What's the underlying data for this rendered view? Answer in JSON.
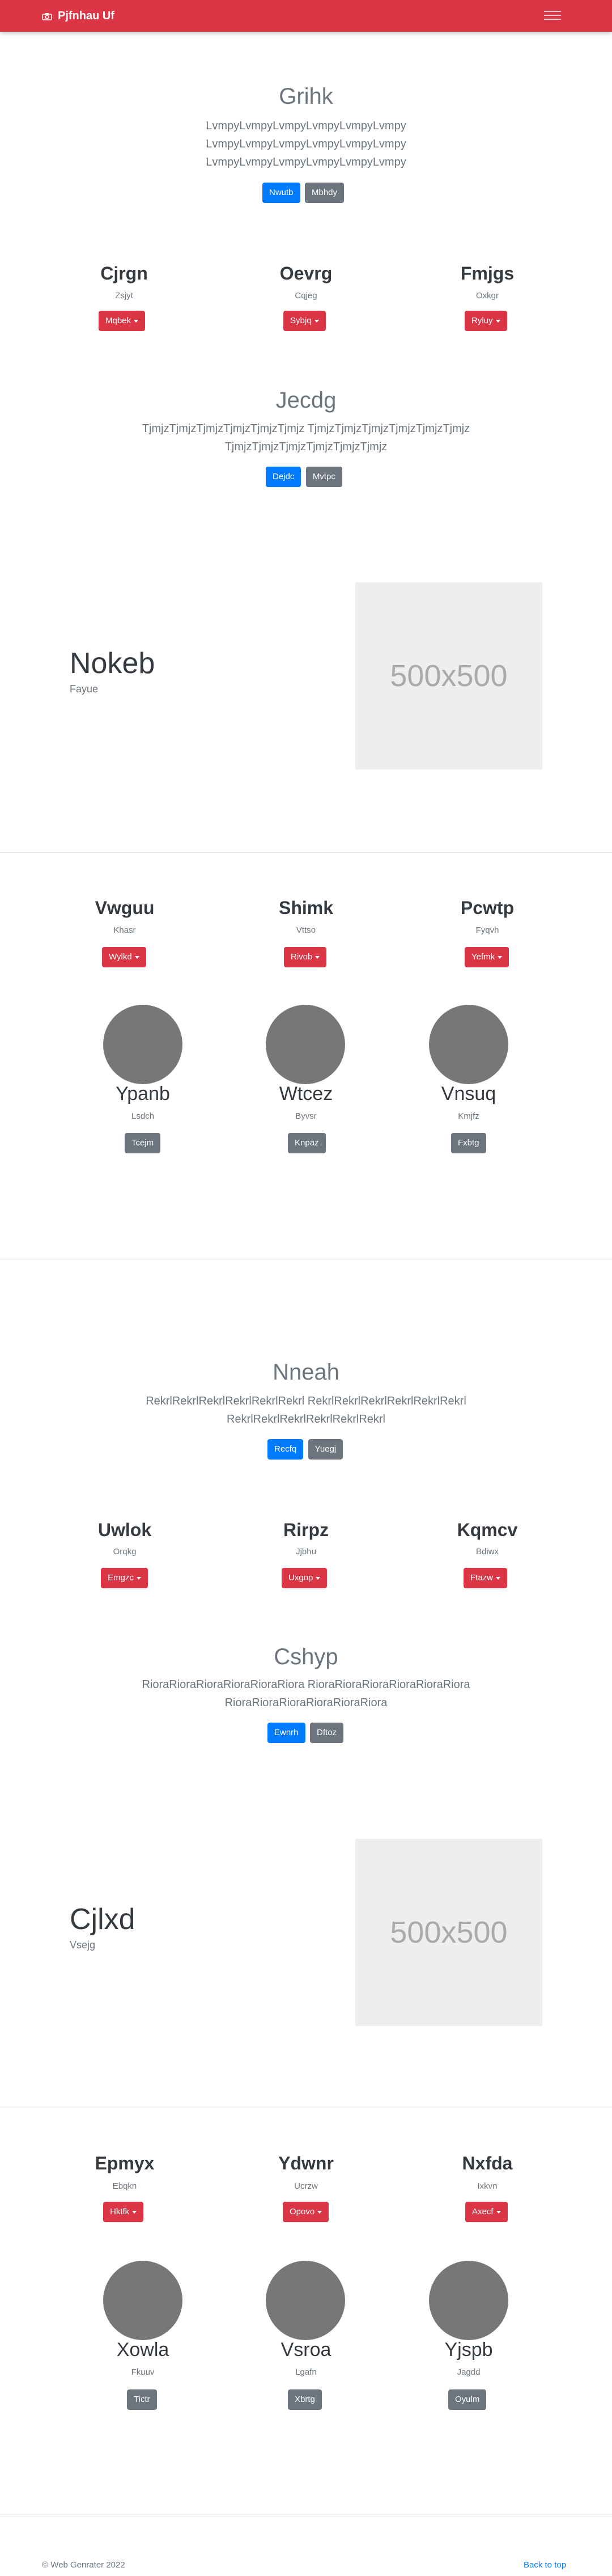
{
  "navbar": {
    "brand": "Pjfnhau Uf"
  },
  "hero1": {
    "title": "Grihk",
    "lines": [
      "LvmpyLvmpyLvmpyLvmpyLvmpyLvmpy",
      "LvmpyLvmpyLvmpyLvmpyLvmpyLvmpy",
      "LvmpyLvmpyLvmpyLvmpyLvmpyLvmpy"
    ],
    "btn_primary": "Nwutb",
    "btn_secondary": "Mbhdy"
  },
  "cols1": [
    {
      "title": "Cjrgn",
      "sub": "Zsjyt",
      "btn": "Mqbek"
    },
    {
      "title": "Oevrg",
      "sub": "Cqjeg",
      "btn": "Sybjq"
    },
    {
      "title": "Fmjgs",
      "sub": "Oxkgr",
      "btn": "Ryluy"
    }
  ],
  "hero2": {
    "title": "Jecdg",
    "lines": [
      "TjmjzTjmjzTjmjzTjmjzTjmjzTjmjz TjmjzTjmjzTjmjzTjmjzTjmjzTjmjz",
      "TjmjzTjmjzTjmjzTjmjzTjmjzTjmjz"
    ],
    "btn_primary": "Dejdc",
    "btn_secondary": "Mvtpc"
  },
  "feature1": {
    "title": "Nokeb",
    "sub": "Fayue",
    "image_text": "500x500"
  },
  "cols2": [
    {
      "title": "Vwguu",
      "sub": "Khasr",
      "btn": "Wylkd"
    },
    {
      "title": "Shimk",
      "sub": "Vttso",
      "btn": "Rivob"
    },
    {
      "title": "Pcwtp",
      "sub": "Fyqvh",
      "btn": "Yefmk"
    }
  ],
  "avatars1": [
    {
      "title": "Ypanb",
      "sub": "Lsdch",
      "btn": "Tcejm"
    },
    {
      "title": "Wtcez",
      "sub": "Byvsr",
      "btn": "Knpaz"
    },
    {
      "title": "Vnsuq",
      "sub": "Kmjfz",
      "btn": "Fxbtg"
    }
  ],
  "hero3": {
    "title": "Nneah",
    "lines": [
      "RekrlRekrlRekrlRekrlRekrlRekrl RekrlRekrlRekrlRekrlRekrlRekrl",
      "RekrlRekrlRekrlRekrlRekrlRekrl"
    ],
    "btn_primary": "Recfq",
    "btn_secondary": "Yuegj"
  },
  "cols3": [
    {
      "title": "Uwlok",
      "sub": "Orqkg",
      "btn": "Emgzc"
    },
    {
      "title": "Rirpz",
      "sub": "Jjbhu",
      "btn": "Uxgop"
    },
    {
      "title": "Kqmcv",
      "sub": "Bdiwx",
      "btn": "Ftazw"
    }
  ],
  "hero4": {
    "title": "Cshyp",
    "lines": [
      "RioraRioraRioraRioraRioraRiora RioraRioraRioraRioraRioraRiora",
      "RioraRioraRioraRioraRioraRiora"
    ],
    "btn_primary": "Ewnrh",
    "btn_secondary": "Dftoz"
  },
  "feature2": {
    "title": "Cjlxd",
    "sub": "Vsejg",
    "image_text": "500x500"
  },
  "cols4": [
    {
      "title": "Epmyx",
      "sub": "Ebqkn",
      "btn": "Hktfk"
    },
    {
      "title": "Ydwnr",
      "sub": "Ucrzw",
      "btn": "Opovo"
    },
    {
      "title": "Nxfda",
      "sub": "Ixkvn",
      "btn": "Axecf"
    }
  ],
  "avatars2": [
    {
      "title": "Xowla",
      "sub": "Fkuuv",
      "btn": "Tictr"
    },
    {
      "title": "Vsroa",
      "sub": "Lgafn",
      "btn": "Xbrtg"
    },
    {
      "title": "Yjspb",
      "sub": "Jagdd",
      "btn": "Oyulm"
    }
  ],
  "footer": {
    "copyright": "© Web Genrater 2022",
    "back_to_top": "Back to top"
  },
  "colors": {
    "primary": "#007bff",
    "secondary": "#6c757d",
    "danger": "#dc3545"
  }
}
